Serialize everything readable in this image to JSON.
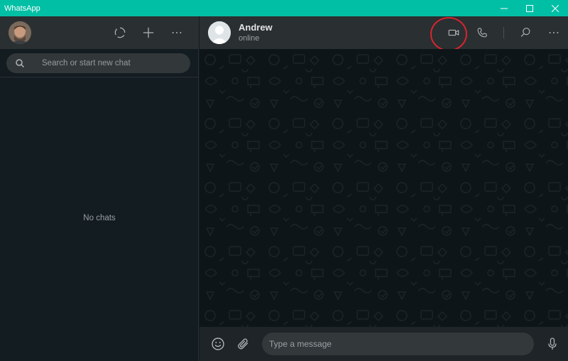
{
  "window": {
    "title": "WhatsApp",
    "accent_color": "#00bfa5"
  },
  "sidebar": {
    "header_icons": [
      "status-icon",
      "new-chat-icon",
      "menu-icon"
    ],
    "search": {
      "placeholder": "Search or start new chat"
    },
    "empty_text": "No chats"
  },
  "chat": {
    "contact_name": "Andrew",
    "contact_status": "online",
    "header_icons": [
      "video-call-icon",
      "voice-call-icon",
      "search-icon",
      "menu-icon"
    ],
    "highlight_color": "#d7262e",
    "composer": {
      "placeholder": "Type a message",
      "icons": [
        "emoji-icon",
        "attach-icon",
        "mic-icon"
      ]
    }
  }
}
